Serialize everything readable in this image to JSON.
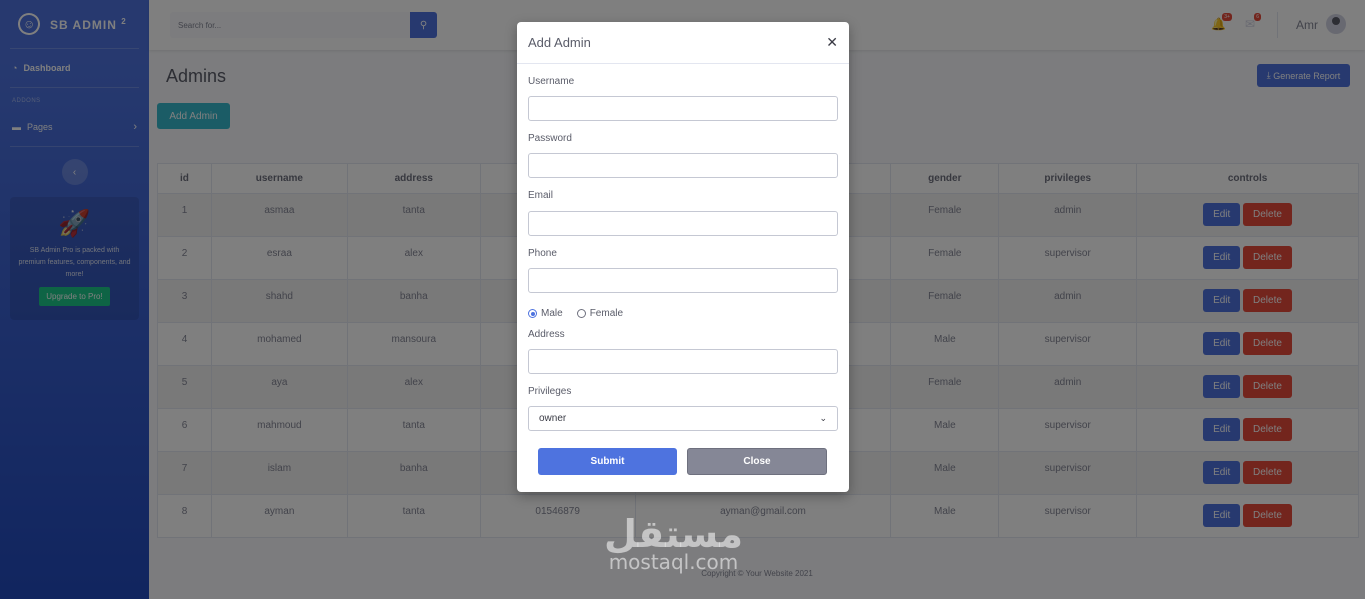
{
  "brand": {
    "name": "SB ADMIN",
    "version": "2"
  },
  "sidebar": {
    "dashboard_label": "Dashboard",
    "heading": "ADDONS",
    "pages_label": "Pages",
    "promo_text": "SB Admin Pro is packed with premium features, components, and more!",
    "promo_button": "Upgrade to Pro!"
  },
  "topbar": {
    "search_placeholder": "Search for...",
    "alerts_count": "3+",
    "messages_count": "6",
    "user_name": "Amr"
  },
  "main": {
    "page_title": "Admins",
    "report_button": "Generate Report",
    "add_admin_button": "Add Admin",
    "table": {
      "headers": [
        "id",
        "username",
        "address",
        "",
        "",
        "gender",
        "privileges",
        "controls"
      ],
      "rows": [
        {
          "id": "1",
          "username": "asmaa",
          "address": "tanta",
          "phone": "",
          "email": "",
          "gender": "Female",
          "privileges": "admin"
        },
        {
          "id": "2",
          "username": "esraa",
          "address": "alex",
          "phone": "",
          "email": "",
          "gender": "Female",
          "privileges": "supervisor"
        },
        {
          "id": "3",
          "username": "shahd",
          "address": "banha",
          "phone": "",
          "email": "",
          "gender": "Female",
          "privileges": "admin"
        },
        {
          "id": "4",
          "username": "mohamed",
          "address": "mansoura",
          "phone": "",
          "email": "",
          "gender": "Male",
          "privileges": "supervisor"
        },
        {
          "id": "5",
          "username": "aya",
          "address": "alex",
          "phone": "",
          "email": "",
          "gender": "Female",
          "privileges": "admin"
        },
        {
          "id": "6",
          "username": "mahmoud",
          "address": "tanta",
          "phone": "",
          "email": "",
          "gender": "Male",
          "privileges": "supervisor"
        },
        {
          "id": "7",
          "username": "islam",
          "address": "banha",
          "phone": "",
          "email": "",
          "gender": "Male",
          "privileges": "supervisor"
        },
        {
          "id": "8",
          "username": "ayman",
          "address": "tanta",
          "phone": "01546879",
          "email": "ayman@gmail.com",
          "gender": "Male",
          "privileges": "supervisor"
        }
      ],
      "edit_label": "Edit",
      "delete_label": "Delete"
    },
    "footer": "Copyright © Your Website 2021"
  },
  "modal": {
    "title": "Add Admin",
    "username_label": "Username",
    "password_label": "Password",
    "email_label": "Email",
    "phone_label": "Phone",
    "male_label": "Male",
    "female_label": "Female",
    "gender_selected": "Male",
    "address_label": "Address",
    "privileges_label": "Privileges",
    "privileges_value": "owner",
    "submit_button": "Submit",
    "close_button": "Close"
  },
  "watermark": {
    "arabic": "مستقل",
    "latin": "mostaql.com"
  },
  "colors": {
    "primary": "#4e73df",
    "info": "#36b9cc",
    "danger": "#e74a3b",
    "secondary": "#858796",
    "success": "#1cc88a"
  }
}
